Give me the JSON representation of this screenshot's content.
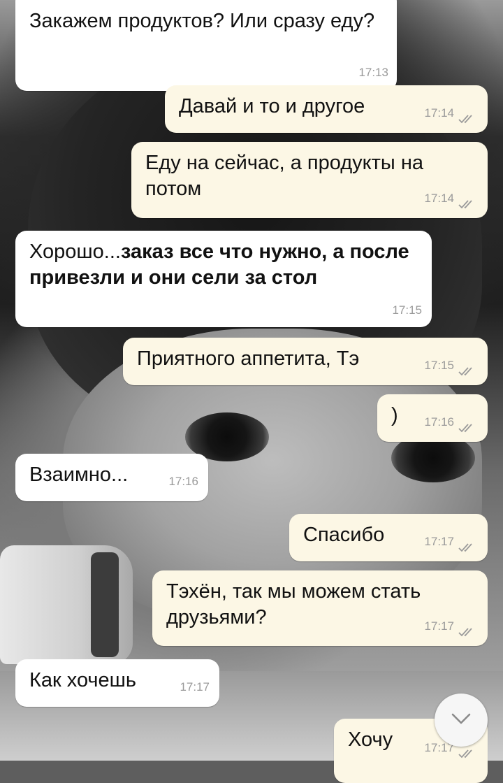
{
  "messages": [
    {
      "dir": "in",
      "text": "Закажем продуктов? Или сразу еду?",
      "time": "17:13"
    },
    {
      "dir": "out",
      "text": "Давай и то и другое",
      "time": "17:14"
    },
    {
      "dir": "out",
      "text": "Еду на сейчас, а продукты на потом",
      "time": "17:14"
    },
    {
      "dir": "in",
      "text": "Хорошо...",
      "bold": "заказ все что нужно, а после привезли и они сели за стол",
      "time": "17:15"
    },
    {
      "dir": "out",
      "text": "Приятного аппетита, Тэ",
      "time": "17:15"
    },
    {
      "dir": "out",
      "text": ")",
      "time": "17:16"
    },
    {
      "dir": "in",
      "text": "Взаимно...",
      "time": "17:16"
    },
    {
      "dir": "out",
      "text": "Спасибо",
      "time": "17:17"
    },
    {
      "dir": "out",
      "text": "Тэхён, так мы можем стать друзьями?",
      "time": "17:17"
    },
    {
      "dir": "in",
      "text": "Как хочешь",
      "time": "17:17"
    },
    {
      "dir": "out",
      "text": "Хочу",
      "time": "17:17"
    }
  ],
  "icons": {
    "read_ticks": "double-check-icon",
    "scroll_down": "chevron-down-icon"
  },
  "colors": {
    "incoming_bubble": "#ffffff",
    "outgoing_bubble": "#fcf7e5",
    "timestamp": "#9a9a9a",
    "read_ticks": "#9a9a9a"
  }
}
